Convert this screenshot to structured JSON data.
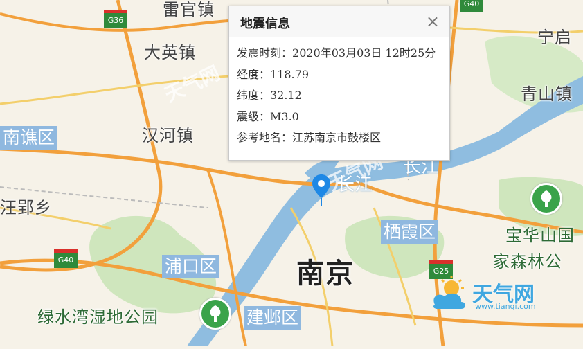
{
  "popup": {
    "title": "地震信息",
    "close_glyph": "×",
    "rows": [
      {
        "label": "发震时刻：",
        "value": "2020年03月03日 12时25分"
      },
      {
        "label": "经度：",
        "value": "118.79"
      },
      {
        "label": "纬度：",
        "value": "32.12"
      },
      {
        "label": "震级：",
        "value": "M3.0"
      },
      {
        "label": "参考地名：",
        "value": "江苏南京市鼓楼区"
      }
    ]
  },
  "map": {
    "towns": [
      "雷官镇",
      "大英镇",
      "汉河镇",
      "汪郢乡",
      "青山镇",
      "宁启"
    ],
    "districts": [
      "南谯区",
      "浦口区",
      "建邺区",
      "栖霞区"
    ],
    "city": "南京",
    "water": [
      "长江",
      "长江"
    ],
    "parks": [
      "绿水湾湿地公园",
      "宝华山国",
      "家森林公"
    ],
    "highways": [
      "G36",
      "G40",
      "G40",
      "G25"
    ],
    "marker_icon": "location-pin-icon",
    "park_icon": "tree-icon"
  },
  "branding": {
    "name": "天气网",
    "url": "www.tianqi.com",
    "watermark": "天气网"
  },
  "colors": {
    "land": "#f6f2e8",
    "park": "#cfe6bd",
    "water": "#8fbde0",
    "highway": "#f2a03c",
    "district_label_bg": "#8fb8df",
    "marker": "#1e88e5"
  }
}
